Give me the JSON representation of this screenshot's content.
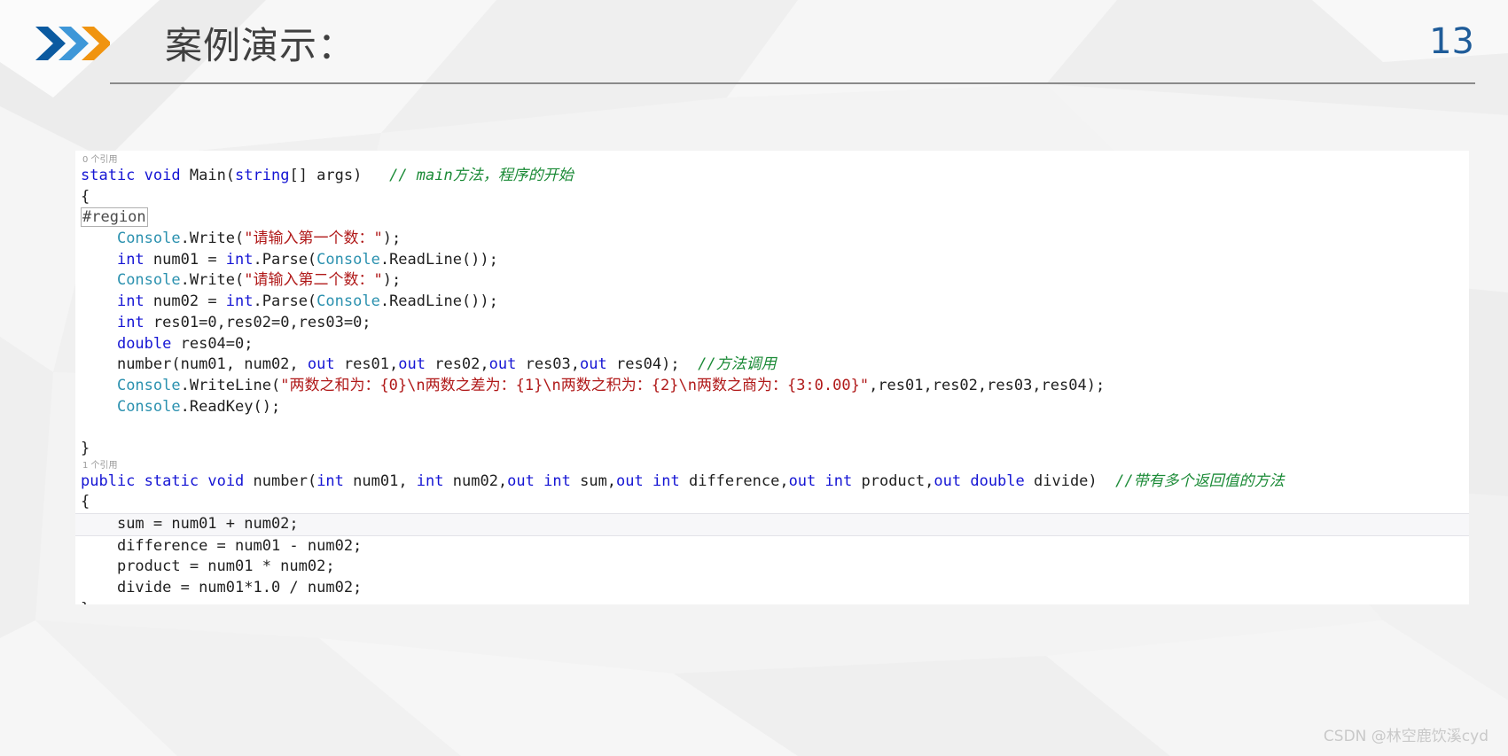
{
  "header": {
    "title": "案例演示：",
    "page_number": "13",
    "logo_icon": "triple-chevron-icon",
    "accent_colors": {
      "chevron_dark_blue": "#0b5aa0",
      "chevron_light_blue": "#3e97d8",
      "chevron_orange": "#f09410",
      "page_number": "#1f5c99",
      "title_text": "#404040",
      "rule": "#8a8a8a"
    }
  },
  "code_panel": {
    "language": "csharp",
    "syntax_colors": {
      "keyword": "#1515d4",
      "type": "#2b91af",
      "string": "#b01919",
      "comment": "#1a8a36",
      "plain": "#1f1f1f",
      "background": "#ffffff"
    },
    "codelens_top": "0 个引用",
    "codelens_mid": "1 个引用",
    "region_label": "#region",
    "lines": [
      {
        "indent": 0,
        "tokens": [
          {
            "t": "static",
            "c": "kw"
          },
          {
            "t": " ",
            "c": "pln"
          },
          {
            "t": "void",
            "c": "kw"
          },
          {
            "t": " Main(",
            "c": "pln"
          },
          {
            "t": "string",
            "c": "kw"
          },
          {
            "t": "[] args)",
            "c": "pln"
          },
          {
            "t": "   ",
            "c": "pln"
          },
          {
            "t": "// main方法，程序的开始",
            "c": "cmt"
          }
        ]
      },
      {
        "indent": 0,
        "tokens": [
          {
            "t": "{",
            "c": "pln"
          }
        ]
      },
      {
        "indent": 0,
        "tokens": [
          {
            "t": "",
            "c": "region"
          }
        ]
      },
      {
        "indent": 1,
        "tokens": [
          {
            "t": "Console",
            "c": "typ"
          },
          {
            "t": ".Write(",
            "c": "pln"
          },
          {
            "t": "\"请输入第一个数：\"",
            "c": "str"
          },
          {
            "t": ");",
            "c": "pln"
          }
        ]
      },
      {
        "indent": 1,
        "tokens": [
          {
            "t": "int",
            "c": "kw"
          },
          {
            "t": " num01 = ",
            "c": "pln"
          },
          {
            "t": "int",
            "c": "kw"
          },
          {
            "t": ".Parse(",
            "c": "pln"
          },
          {
            "t": "Console",
            "c": "typ"
          },
          {
            "t": ".ReadLine());",
            "c": "pln"
          }
        ]
      },
      {
        "indent": 1,
        "tokens": [
          {
            "t": "Console",
            "c": "typ"
          },
          {
            "t": ".Write(",
            "c": "pln"
          },
          {
            "t": "\"请输入第二个数：\"",
            "c": "str"
          },
          {
            "t": ");",
            "c": "pln"
          }
        ]
      },
      {
        "indent": 1,
        "tokens": [
          {
            "t": "int",
            "c": "kw"
          },
          {
            "t": " num02 = ",
            "c": "pln"
          },
          {
            "t": "int",
            "c": "kw"
          },
          {
            "t": ".Parse(",
            "c": "pln"
          },
          {
            "t": "Console",
            "c": "typ"
          },
          {
            "t": ".ReadLine());",
            "c": "pln"
          }
        ]
      },
      {
        "indent": 1,
        "tokens": [
          {
            "t": "int",
            "c": "kw"
          },
          {
            "t": " res01=0,res02=0,res03=0;",
            "c": "pln"
          }
        ]
      },
      {
        "indent": 1,
        "tokens": [
          {
            "t": "double",
            "c": "kw"
          },
          {
            "t": " res04=0;",
            "c": "pln"
          }
        ]
      },
      {
        "indent": 1,
        "tokens": [
          {
            "t": "number(num01, num02, ",
            "c": "pln"
          },
          {
            "t": "out",
            "c": "kw"
          },
          {
            "t": " res01,",
            "c": "pln"
          },
          {
            "t": "out",
            "c": "kw"
          },
          {
            "t": " res02,",
            "c": "pln"
          },
          {
            "t": "out",
            "c": "kw"
          },
          {
            "t": " res03,",
            "c": "pln"
          },
          {
            "t": "out",
            "c": "kw"
          },
          {
            "t": " res04);  ",
            "c": "pln"
          },
          {
            "t": "//方法调用",
            "c": "cmt"
          }
        ]
      },
      {
        "indent": 1,
        "tokens": [
          {
            "t": "Console",
            "c": "typ"
          },
          {
            "t": ".WriteLine(",
            "c": "pln"
          },
          {
            "t": "\"两数之和为：{0}\\n两数之差为：{1}\\n两数之积为：{2}\\n两数之商为：{3:0.00}\"",
            "c": "str"
          },
          {
            "t": ",res01,res02,res03,res04);",
            "c": "pln"
          }
        ]
      },
      {
        "indent": 1,
        "tokens": [
          {
            "t": "Console",
            "c": "typ"
          },
          {
            "t": ".ReadKey();",
            "c": "pln"
          }
        ]
      },
      {
        "indent": 0,
        "tokens": [
          {
            "t": "",
            "c": "pln"
          }
        ]
      },
      {
        "indent": 0,
        "tokens": [
          {
            "t": "}",
            "c": "pln"
          }
        ]
      },
      {
        "indent": 0,
        "tokens": [
          {
            "t": "public",
            "c": "kw"
          },
          {
            "t": " ",
            "c": "pln"
          },
          {
            "t": "static",
            "c": "kw"
          },
          {
            "t": " ",
            "c": "pln"
          },
          {
            "t": "void",
            "c": "kw"
          },
          {
            "t": " number(",
            "c": "pln"
          },
          {
            "t": "int",
            "c": "kw"
          },
          {
            "t": " num01, ",
            "c": "pln"
          },
          {
            "t": "int",
            "c": "kw"
          },
          {
            "t": " num02,",
            "c": "pln"
          },
          {
            "t": "out",
            "c": "kw"
          },
          {
            "t": " ",
            "c": "pln"
          },
          {
            "t": "int",
            "c": "kw"
          },
          {
            "t": " sum,",
            "c": "pln"
          },
          {
            "t": "out",
            "c": "kw"
          },
          {
            "t": " ",
            "c": "pln"
          },
          {
            "t": "int",
            "c": "kw"
          },
          {
            "t": " difference,",
            "c": "pln"
          },
          {
            "t": "out",
            "c": "kw"
          },
          {
            "t": " ",
            "c": "pln"
          },
          {
            "t": "int",
            "c": "kw"
          },
          {
            "t": " product,",
            "c": "pln"
          },
          {
            "t": "out",
            "c": "kw"
          },
          {
            "t": " ",
            "c": "pln"
          },
          {
            "t": "double",
            "c": "kw"
          },
          {
            "t": " divide)  ",
            "c": "pln"
          },
          {
            "t": "//带有多个返回值的方法",
            "c": "cmt"
          }
        ]
      },
      {
        "indent": 0,
        "tokens": [
          {
            "t": "{",
            "c": "pln"
          }
        ]
      },
      {
        "indent": 1,
        "tokens": [
          {
            "t": "sum = num01 + num02;",
            "c": "pln"
          }
        ]
      },
      {
        "indent": 1,
        "tokens": [
          {
            "t": "difference = num01 - num02;",
            "c": "pln"
          }
        ]
      },
      {
        "indent": 1,
        "tokens": [
          {
            "t": "product = num01 * num02;",
            "c": "pln"
          }
        ]
      },
      {
        "indent": 1,
        "tokens": [
          {
            "t": "divide = num01*1.0 / num02;",
            "c": "pln"
          }
        ]
      },
      {
        "indent": 0,
        "tokens": [
          {
            "t": "}",
            "c": "pln"
          }
        ]
      }
    ]
  },
  "watermark": {
    "text": "CSDN @林空鹿饮溪cyd"
  }
}
